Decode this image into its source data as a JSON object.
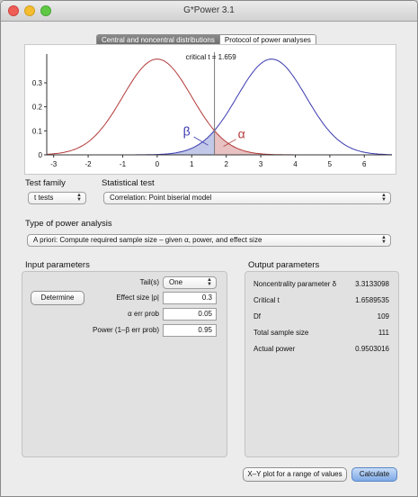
{
  "window": {
    "title": "G*Power 3.1"
  },
  "tabs": [
    {
      "label": "Central and noncentral distributions",
      "active": true
    },
    {
      "label": "Protocol of power analyses",
      "active": false
    }
  ],
  "plot": {
    "critical_label": "critical t = 1.659",
    "beta_symbol": "β",
    "alpha_symbol": "α",
    "colors": {
      "central": "#b23a3a",
      "noncentral": "#3a3ab0",
      "critical": "#777777"
    }
  },
  "chart_data": {
    "type": "line",
    "title": "critical t = 1.659",
    "x_ticks": [
      "-3",
      "-2",
      "-1",
      "0",
      "1",
      "2",
      "3",
      "4",
      "5",
      "6"
    ],
    "y_ticks": [
      "0",
      "0.1",
      "0.2",
      "0.3"
    ],
    "xlim": [
      -3.2,
      6.8
    ],
    "ylim": [
      0,
      0.42
    ],
    "critical_t": 1.659,
    "series": [
      {
        "mean": 0,
        "sd": 1,
        "color": "#b23a3a"
      },
      {
        "mean": 3.313,
        "sd": 1,
        "color": "#3a3ab0"
      }
    ]
  },
  "test_family": {
    "heading": "Test family",
    "value": "t tests"
  },
  "statistical_test": {
    "heading": "Statistical test",
    "value": "Correlation: Point biserial model"
  },
  "power_analysis": {
    "heading": "Type of power analysis",
    "value": "A priori: Compute required sample size – given α, power, and effect size"
  },
  "input": {
    "heading": "Input parameters",
    "determine": "Determine",
    "tails": {
      "label": "Tail(s)",
      "value": "One"
    },
    "effect_size": {
      "label": "Effect size |ρ|",
      "value": "0.3"
    },
    "alpha": {
      "label": "α err prob",
      "value": "0.05"
    },
    "power": {
      "label": "Power (1–β err prob)",
      "value": "0.95"
    }
  },
  "output": {
    "heading": "Output parameters",
    "rows": [
      {
        "label": "Noncentrality parameter δ",
        "value": "3.3133098"
      },
      {
        "label": "Critical t",
        "value": "1.6589535"
      },
      {
        "label": "Df",
        "value": "109"
      },
      {
        "label": "Total sample size",
        "value": "111"
      },
      {
        "label": "Actual power",
        "value": "0.9503016"
      }
    ]
  },
  "buttons": {
    "xy_plot": "X–Y plot for a range of values",
    "calculate": "Calculate"
  }
}
